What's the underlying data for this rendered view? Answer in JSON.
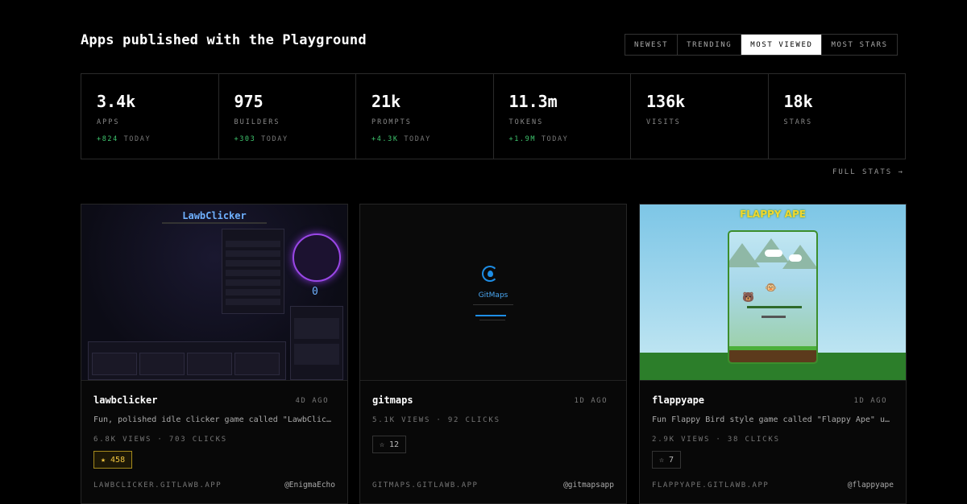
{
  "page": {
    "title": "Apps published with the Playground"
  },
  "tabs": [
    {
      "label": "NEWEST"
    },
    {
      "label": "TRENDING"
    },
    {
      "label": "MOST VIEWED"
    },
    {
      "label": "MOST STARS"
    }
  ],
  "stats": [
    {
      "value": "3.4k",
      "label": "APPS",
      "delta": "+824",
      "today": "TODAY"
    },
    {
      "value": "975",
      "label": "BUILDERS",
      "delta": "+303",
      "today": "TODAY"
    },
    {
      "value": "21k",
      "label": "PROMPTS",
      "delta": "+4.3K",
      "today": "TODAY"
    },
    {
      "value": "11.3m",
      "label": "TOKENS",
      "delta": "+1.9M",
      "today": "TODAY"
    },
    {
      "value": "136k",
      "label": "VISITS"
    },
    {
      "value": "18k",
      "label": "STARS"
    }
  ],
  "full_stats_label": "FULL STATS →",
  "cards": [
    {
      "name": "lawbclicker",
      "age": "4D AGO",
      "description": "Fun, polished idle clicker game called \"LawbClicker\" where you tap to earn",
      "metrics": "6.8K VIEWS · 703 CLICKS",
      "stars": "458",
      "domain": "LAWBCLICKER.GITLAWB.APP",
      "author": "@EnigmaEcho",
      "thumb": {
        "title": "LawbClicker",
        "counter": "0"
      }
    },
    {
      "name": "gitmaps",
      "age": "1D AGO",
      "metrics": "5.1K VIEWS · 92 CLICKS",
      "stars": "12",
      "domain": "GITMAPS.GITLAWB.APP",
      "author": "@gitmapsapp",
      "thumb": {
        "title": "GitMaps"
      }
    },
    {
      "name": "flappyape",
      "age": "1D AGO",
      "description": "Fun Flappy Bird style game called \"Flappy Ape\" using the ape emoji",
      "metrics": "2.9K VIEWS · 38 CLICKS",
      "stars": "7",
      "domain": "FLAPPYAPE.GITLAWB.APP",
      "author": "@flappyape",
      "thumb": {
        "title": "FLAPPY APE"
      }
    }
  ],
  "colors": {
    "accent_green": "#3ec46d",
    "star_gold": "#f1c640",
    "gitmaps_blue": "#1e8ee6",
    "clicker_purple": "#9a47e6"
  },
  "icons": {
    "star": "star-icon",
    "ape": "monkey-face-icon",
    "bear": "bear-face-icon",
    "drop": "water-drop-icon"
  }
}
